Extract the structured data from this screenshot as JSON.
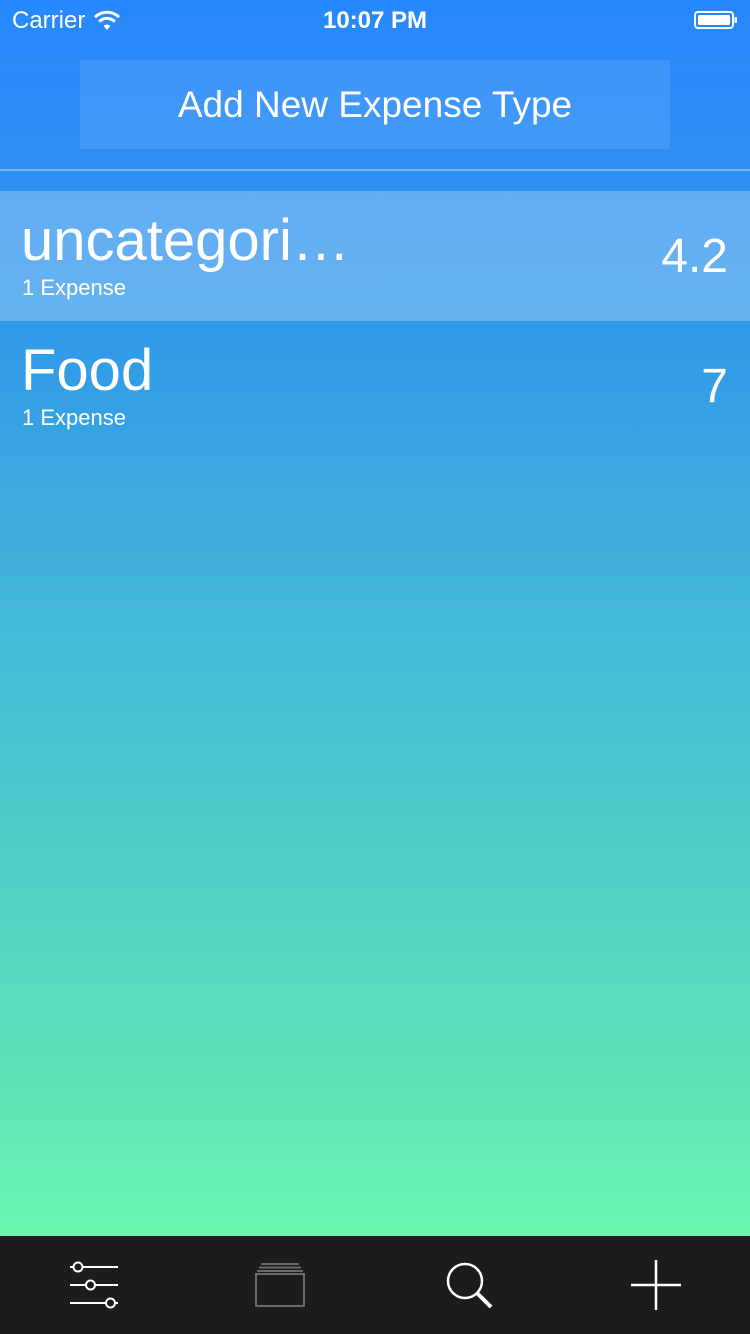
{
  "status_bar": {
    "carrier": "Carrier",
    "time": "10:07 PM",
    "wifi_icon": "wifi-icon",
    "battery_icon": "battery-icon"
  },
  "header": {
    "add_button_label": "Add New Expense Type"
  },
  "expense_types": [
    {
      "name": "uncategori…",
      "count_label": "1 Expense",
      "amount": "4.2",
      "selected": true
    },
    {
      "name": "Food",
      "count_label": "1 Expense",
      "amount": "7",
      "selected": false
    }
  ],
  "tab_bar": {
    "items": [
      {
        "icon": "sliders-icon"
      },
      {
        "icon": "stack-icon"
      },
      {
        "icon": "search-icon"
      },
      {
        "icon": "plus-icon"
      }
    ]
  },
  "colors": {
    "gradient_top": "#2688fd",
    "gradient_bottom": "#6bf5b0",
    "tab_bar_background": "#1c1c1c",
    "text": "#ffffff"
  }
}
